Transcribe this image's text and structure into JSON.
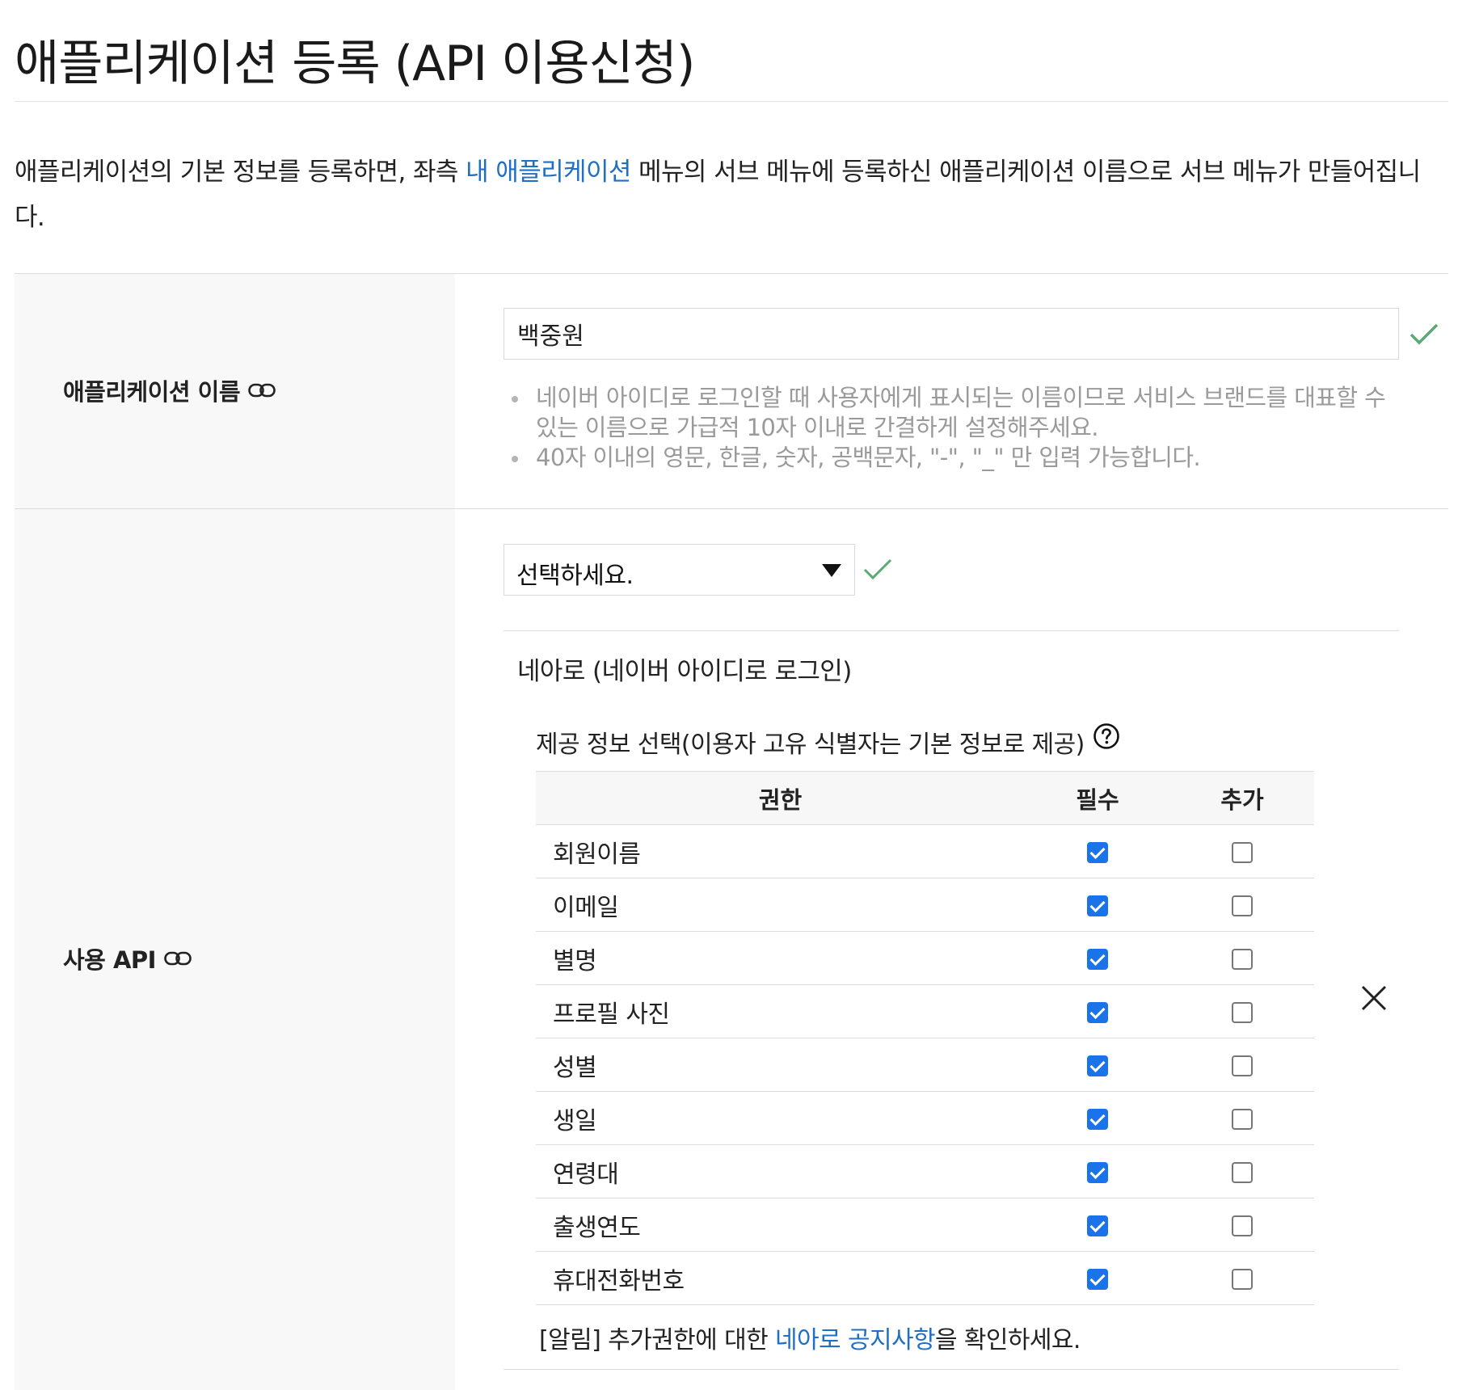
{
  "page": {
    "title": "애플리케이션 등록 (API 이용신청)"
  },
  "intro": {
    "text_before": "애플리케이션의 기본 정보를 등록하면, 좌측 ",
    "link": "내 애플리케이션",
    "text_after": " 메뉴의 서브 메뉴에 등록하신 애플리케이션 이름으로 서브 메뉴가 만들어집니다."
  },
  "app_name": {
    "label": "애플리케이션 이름",
    "value": "백중원",
    "hints": [
      "네이버 아이디로 로그인할 때 사용자에게 표시되는 이름이므로 서비스 브랜드를 대표할 수 있는 이름으로 가급적 10자 이내로 간결하게 설정해주세요.",
      "40자 이내의 영문, 한글, 숫자, 공백문자, \"-\", \"_\" 만 입력 가능합니다."
    ]
  },
  "api": {
    "label": "사용 API",
    "select_value": "선택하세요.",
    "api_name": "네아로 (네이버 아이디로 로그인)",
    "info_title": "제공 정보 선택(이용자 고유 식별자는 기본 정보로 제공)",
    "table": {
      "headers": [
        "권한",
        "필수",
        "추가"
      ],
      "rows": [
        {
          "name": "회원이름",
          "required": true,
          "additional": false
        },
        {
          "name": "이메일",
          "required": true,
          "additional": false
        },
        {
          "name": "별명",
          "required": true,
          "additional": false
        },
        {
          "name": "프로필 사진",
          "required": true,
          "additional": false
        },
        {
          "name": "성별",
          "required": true,
          "additional": false
        },
        {
          "name": "생일",
          "required": true,
          "additional": false
        },
        {
          "name": "연령대",
          "required": true,
          "additional": false
        },
        {
          "name": "출생연도",
          "required": true,
          "additional": false
        },
        {
          "name": "휴대전화번호",
          "required": true,
          "additional": false
        }
      ]
    },
    "notice": {
      "prefix": "[알림] 추가권한에 대한 ",
      "link": "네아로 공지사항",
      "suffix": "을 확인하세요."
    }
  },
  "icons": {
    "link": "link-icon",
    "check": "check-icon",
    "caret": "caret-down-icon",
    "help": "question-circle-icon",
    "close": "close-icon"
  },
  "colors": {
    "accent_link": "#1f6fc5",
    "checkbox_checked": "#1a73e8",
    "valid_check": "#5aab73",
    "label_bg": "#f8f8f8"
  }
}
